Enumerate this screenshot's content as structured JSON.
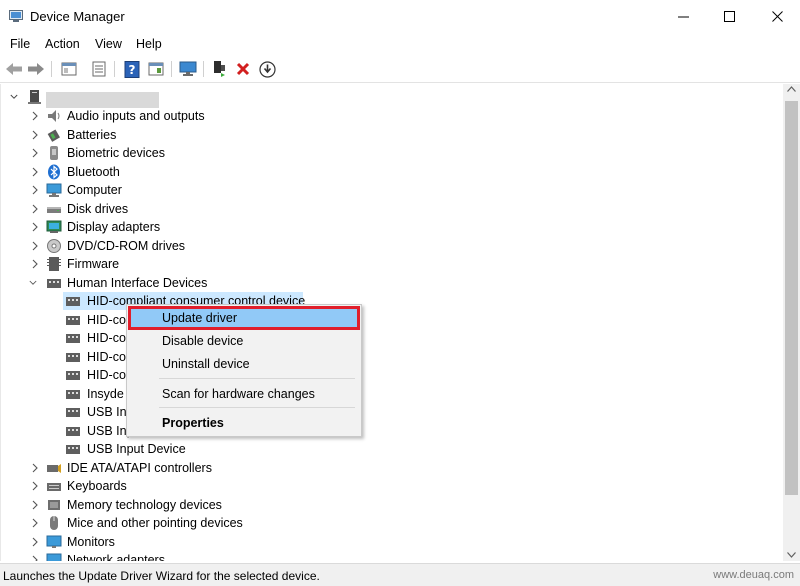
{
  "window": {
    "title": "Device Manager",
    "minimize_glyph": "—",
    "close_glyph": "✕"
  },
  "menu": [
    "File",
    "Action",
    "View",
    "Help"
  ],
  "toolbar_icons": [
    "back-arrow-icon",
    "forward-arrow-icon",
    "properties-icon",
    "list-icon",
    "help-icon",
    "details-icon",
    "monitor-icon",
    "add-driver-icon",
    "uninstall-x-icon",
    "download-driver-icon"
  ],
  "tree": {
    "root_name": "",
    "categories_top": [
      {
        "label": "Audio inputs and outputs",
        "icon": "speaker-icon"
      },
      {
        "label": "Batteries",
        "icon": "battery-icon"
      },
      {
        "label": "Biometric devices",
        "icon": "biometric-icon"
      },
      {
        "label": "Bluetooth",
        "icon": "bluetooth-icon"
      },
      {
        "label": "Computer",
        "icon": "computer-icon"
      },
      {
        "label": "Disk drives",
        "icon": "disk-icon"
      },
      {
        "label": "Display adapters",
        "icon": "display-icon"
      },
      {
        "label": "DVD/CD-ROM drives",
        "icon": "dvd-icon"
      },
      {
        "label": "Firmware",
        "icon": "firmware-icon"
      }
    ],
    "expanded_category": {
      "label": "Human Interface Devices",
      "icon": "hid-icon"
    },
    "hid_children": [
      "HID-compliant consumer control device",
      "HID-con",
      "HID-con",
      "HID-con",
      "HID-con",
      "Insyde A",
      "USB Inpu",
      "USB Inpu",
      "USB Input Device"
    ],
    "categories_bottom": [
      {
        "label": "IDE ATA/ATAPI controllers",
        "icon": "ide-icon"
      },
      {
        "label": "Keyboards",
        "icon": "keyboard-icon"
      },
      {
        "label": "Memory technology devices",
        "icon": "memory-icon"
      },
      {
        "label": "Mice and other pointing devices",
        "icon": "mouse-icon"
      },
      {
        "label": "Monitors",
        "icon": "monitor-icon"
      },
      {
        "label": "Network adapters",
        "icon": "network-icon"
      }
    ]
  },
  "context_menu": {
    "update_driver": "Update driver",
    "disable_device": "Disable device",
    "uninstall_device": "Uninstall device",
    "scan_hardware": "Scan for hardware changes",
    "properties": "Properties"
  },
  "status": {
    "text": "Launches the Update Driver Wizard for the selected device.",
    "watermark": "www.deuaq.com"
  },
  "colors": {
    "highlight_border": "#e01e2b",
    "menu_highlight": "#91c9f7",
    "selection": "#cce8ff",
    "bluetooth": "#1f6fd1"
  }
}
